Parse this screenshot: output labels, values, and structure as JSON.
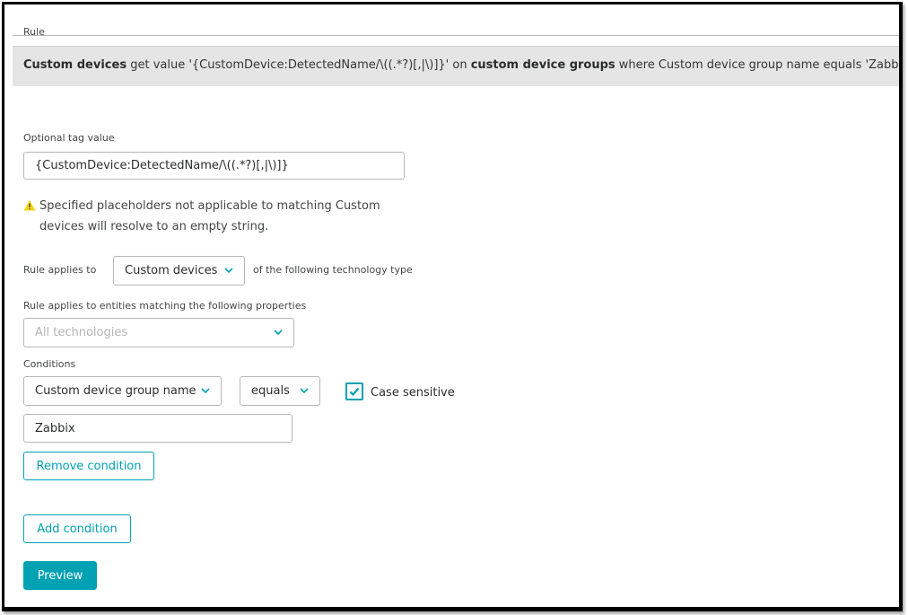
{
  "rule": {
    "section_label": "Rule",
    "summary": {
      "entity": "Custom devices",
      "t1": " get value '",
      "value": "{CustomDevice:DetectedName/\\((.*?)[,|\\)]}",
      "t2": "' on ",
      "group_entity": "custom device groups",
      "t3": " where ",
      "prop": "Custom device group name",
      "t4": " ",
      "op": "equals",
      "t5": " '",
      "cond_value": "Zabbix",
      "t6": "'"
    }
  },
  "tag": {
    "label": "Optional tag value",
    "value": "{CustomDevice:DetectedName/\\((.*?)[,|\\)]}"
  },
  "warning": {
    "icon": "warning-icon",
    "text": "Specified placeholders not applicable to matching Custom devices will resolve to an empty string."
  },
  "applies": {
    "label": "Rule applies to",
    "selected": "Custom devices",
    "suffix": "of the following technology type",
    "entities_label": "Rule applies to entities matching the following properties",
    "technologies_placeholder": "All technologies"
  },
  "conditions": {
    "label": "Conditions",
    "property": "Custom device group name",
    "operator": "equals",
    "case_sensitive_label": "Case sensitive",
    "case_sensitive_checked": true,
    "value": "Zabbix",
    "remove_button": "Remove condition",
    "add_button": "Add condition"
  },
  "preview_button": "Preview",
  "colors": {
    "accent": "#00a1b2",
    "summary_bg": "#e5e5e5",
    "warning": "#f5d30f"
  }
}
